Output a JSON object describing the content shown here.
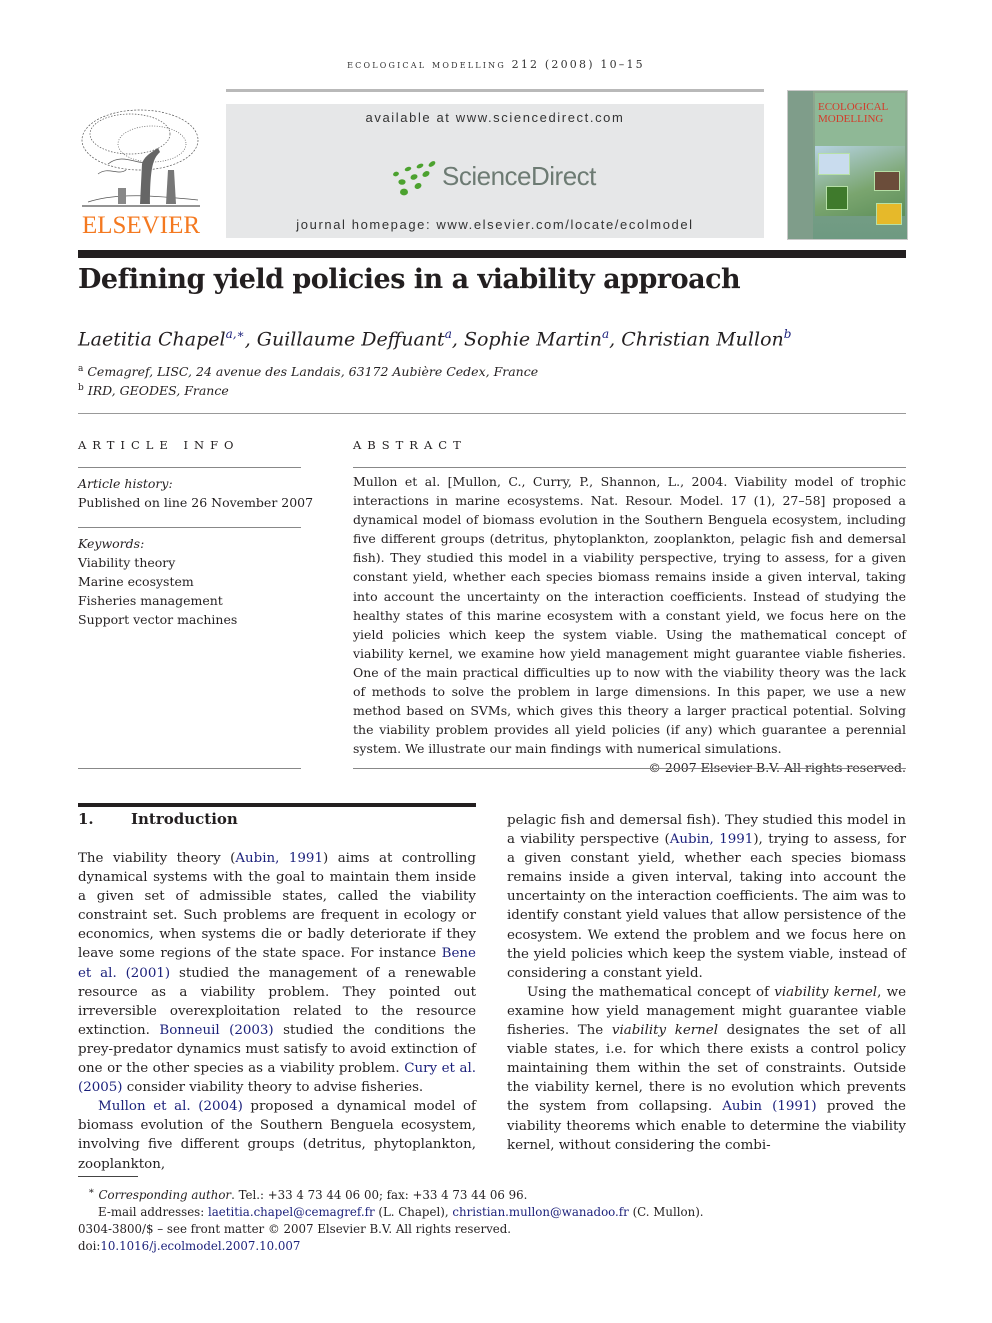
{
  "journal": {
    "running_head": "ECOLOGICAL MODELLING 212 (2008) 10–15",
    "available_at": "available at www.sciencedirect.com",
    "sciencedirect_label": "ScienceDirect",
    "homepage": "journal homepage: www.elsevier.com/locate/ecolmodel",
    "publisher_logo_text": "ELSEVIER",
    "cover": {
      "title_line1": "ECOLOGICAL",
      "title_line2": "MODELLING"
    },
    "colors": {
      "elsevier_orange": "#f47920",
      "sciencedirect_green": "#4ca22f",
      "sciencedirect_gray": "#6d7b73",
      "link_blue": "#1a1f7a"
    }
  },
  "article": {
    "title": "Defining yield policies in a viability approach",
    "authors": [
      {
        "name": "Laetitia Chapel",
        "sup": "a,∗"
      },
      {
        "name": "Guillaume Deffuant",
        "sup": "a"
      },
      {
        "name": "Sophie Martin",
        "sup": "a"
      },
      {
        "name": "Christian Mullon",
        "sup": "b"
      }
    ],
    "affiliations": [
      {
        "mark": "a",
        "text": "Cemagref, LISC, 24 avenue des Landais, 63172 Aubière Cedex, France"
      },
      {
        "mark": "b",
        "text": "IRD, GEODES, France"
      }
    ]
  },
  "article_info": {
    "heading": "ARTICLE INFO",
    "history_label": "Article history:",
    "history_value": "Published on line 26 November 2007",
    "keywords_label": "Keywords:",
    "keywords": [
      "Viability theory",
      "Marine ecosystem",
      "Fisheries management",
      "Support vector machines"
    ]
  },
  "abstract": {
    "heading": "ABSTRACT",
    "text": "Mullon et al. [Mullon, C., Curry, P., Shannon, L., 2004. Viability model of trophic interactions in marine ecosystems. Nat. Resour. Model. 17 (1), 27–58] proposed a dynamical model of biomass evolution in the Southern Benguela ecosystem, including five different groups (detritus, phytoplankton, zooplankton, pelagic fish and demersal fish). They studied this model in a viability perspective, trying to assess, for a given constant yield, whether each species biomass remains inside a given interval, taking into account the uncertainty on the interaction coefficients. Instead of studying the healthy states of this marine ecosystem with a constant yield, we focus here on the yield policies which keep the system viable. Using the mathematical concept of viability kernel, we examine how yield management might guarantee viable fisheries. One of the main practical difficulties up to now with the viability theory was the lack of methods to solve the problem in large dimensions. In this paper, we use a new method based on SVMs, which gives this theory a larger practical potential. Solving the viability problem provides all yield policies (if any) which guarantee a perennial system. We illustrate our main findings with numerical simulations.",
    "copyright": "© 2007 Elsevier B.V. All rights reserved."
  },
  "introduction": {
    "number": "1.",
    "heading": "Introduction",
    "p1": {
      "t1": "The viability theory (",
      "l1": "Aubin, 1991",
      "t2": ") aims at controlling dynamical systems with the goal to maintain them inside a given set of admissible states, called the viability constraint set. Such problems are frequent in ecology or economics, when systems die or badly deteriorate if they leave some regions of the state space. For instance ",
      "l2": "Bene et al. (2001)",
      "t3": " studied the management of a renewable resource as a viability problem. They pointed out irreversible overexploitation related to the resource extinction. ",
      "l3": "Bonneuil (2003)",
      "t4": " studied the conditions the prey-predator dynamics must satisfy to avoid extinction of one or the other species as a viability problem. ",
      "l4": "Cury et al. (2005)",
      "t5": " consider viability theory to advise fisheries."
    },
    "p2": {
      "l1": "Mullon et al. (2004)",
      "t1": " proposed a dynamical model of biomass evolution of the Southern Benguela ecosystem, involving five different groups (detritus, phytoplankton, zooplankton, pelagic fish and demersal fish). They studied this model in a viability perspective (",
      "l2": "Aubin, 1991",
      "t2": "), trying to assess, for a given constant yield, whether each species biomass remains inside a given interval, taking into account the uncertainty on the interaction coefficients. The aim was to identify constant yield values that allow persistence of the ecosystem. We extend the problem and we focus here on the yield policies which keep the system viable, instead of considering a constant yield."
    },
    "p3": {
      "t1": "Using the mathematical concept of ",
      "i1": "viability kernel",
      "t2": ", we examine how yield management might guarantee viable fisheries. The ",
      "i2": "viability kernel",
      "t3": " designates the set of all viable states, i.e. for which there exists a control policy maintaining them within the set of constraints. Outside the viability kernel, there is no evolution which prevents the system from collapsing. ",
      "l1": "Aubin (1991)",
      "t4": " proved the viability theorems which enable to determine the viability kernel, without considering the combi-"
    }
  },
  "footnotes": {
    "star": "∗",
    "corresponding_label": "Corresponding author",
    "contact": ". Tel.: +33 4 73 44 06 00; fax: +33 4 73 44 06 96.",
    "email_label": "E-mail addresses: ",
    "email1": "laetitia.chapel@cemagref.fr",
    "email1_owner": " (L. Chapel), ",
    "email2": "christian.mullon@wanadoo.fr",
    "email2_owner": " (C. Mullon).",
    "front_matter": "0304-3800/$ – see front matter © 2007 Elsevier B.V. All rights reserved.",
    "doi_label": "doi:",
    "doi": "10.1016/j.ecolmodel.2007.10.007"
  }
}
